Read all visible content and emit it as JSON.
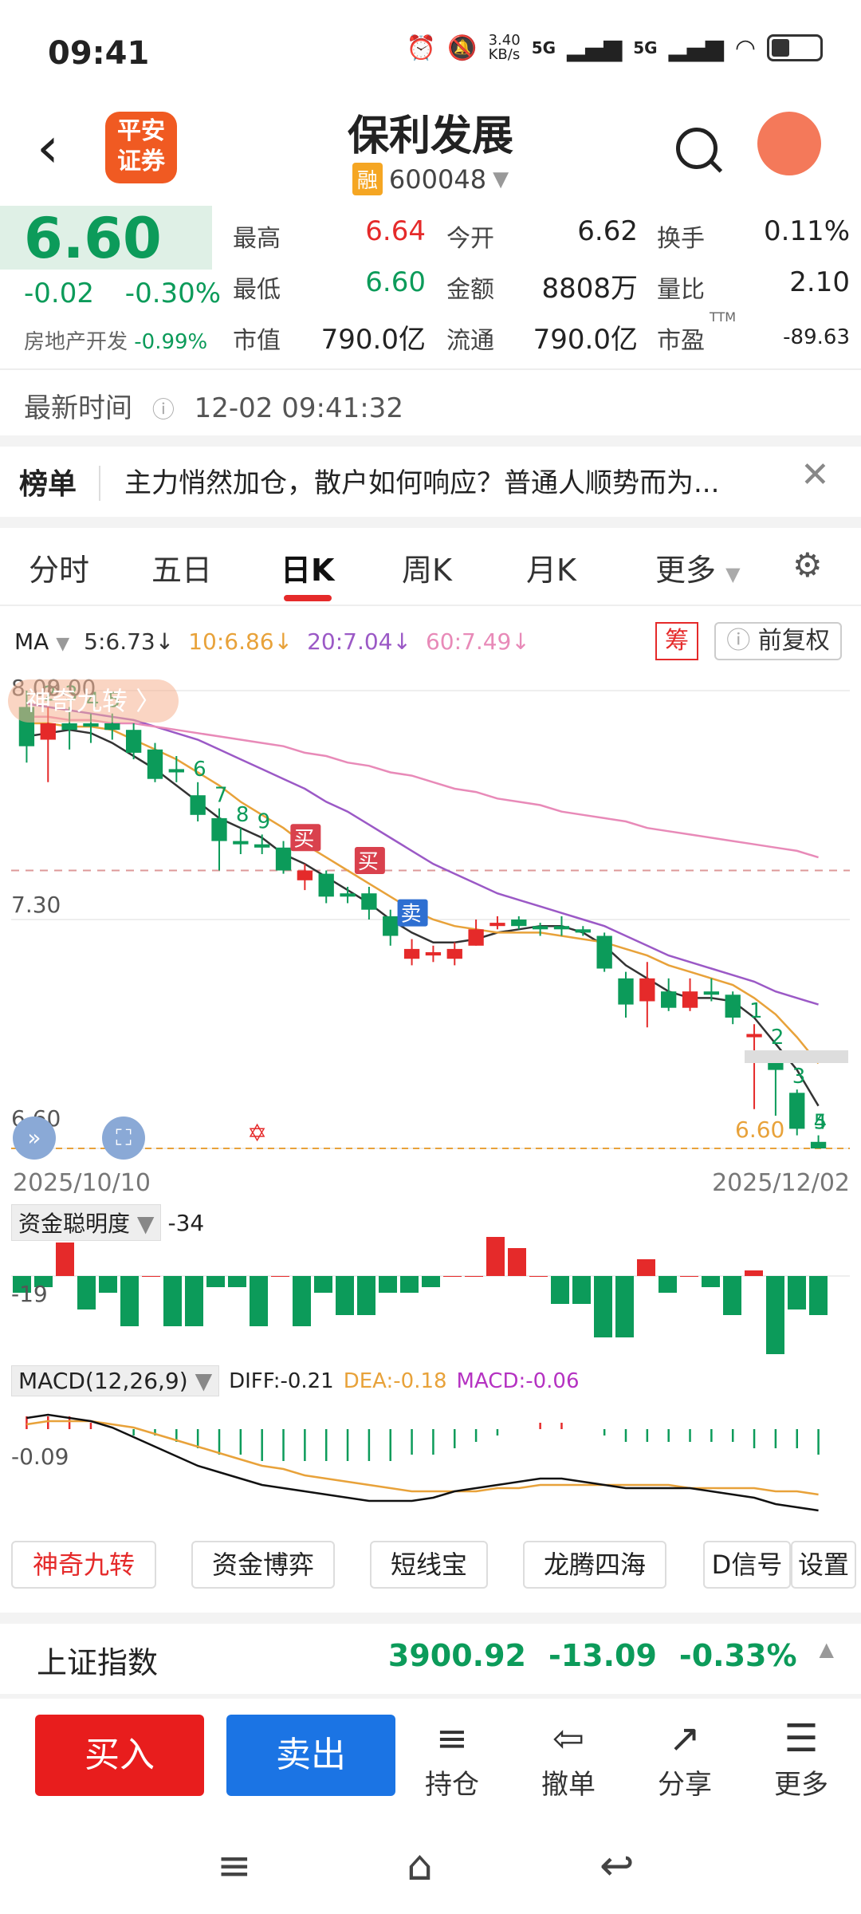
{
  "status": {
    "time": "09:41",
    "net_speed": "3.40\nKB/s",
    "signal1": "5G",
    "signal2": "5G"
  },
  "header": {
    "broker_logo": "平安\n证券",
    "stock_name": "保利发展",
    "rong": "融",
    "stock_code": "600048"
  },
  "quote": {
    "price": "6.60",
    "change": "-0.02",
    "change_pct": "-0.30%",
    "sector": "房地产开发",
    "sector_pct": "-0.99%",
    "items": [
      {
        "label": "最高",
        "value": "6.64",
        "color": "#e52a2a"
      },
      {
        "label": "今开",
        "value": "6.62",
        "color": "#222"
      },
      {
        "label": "换手",
        "value": "0.11%",
        "color": "#222"
      },
      {
        "label": "最低",
        "value": "6.60",
        "color": "#0c9b5a"
      },
      {
        "label": "金额",
        "value": "8808万",
        "color": "#222"
      },
      {
        "label": "量比",
        "value": "2.10",
        "color": "#222"
      },
      {
        "label": "市值",
        "value": "790.0亿",
        "color": "#222"
      },
      {
        "label": "流通",
        "value": "790.0亿",
        "color": "#222"
      },
      {
        "label": "市盈",
        "value": "-89.63",
        "color": "#222"
      }
    ],
    "ttm": "TTM"
  },
  "update": {
    "label": "最新时间",
    "value": "12-02 09:41:32"
  },
  "news": {
    "tag": "榜单",
    "text": "主力悄然加仓，散户如何响应？普通人顺势而为..."
  },
  "tabs": [
    "分时",
    "五日",
    "日K",
    "周K",
    "月K",
    "更多"
  ],
  "ma": {
    "label": "MA",
    "items": [
      {
        "text": "5:6.73↓",
        "color": "#333333"
      },
      {
        "text": "10:6.86↓",
        "color": "#e8a23a"
      },
      {
        "text": "20:7.04↓",
        "color": "#9b59c6"
      },
      {
        "text": "60:7.49↓",
        "color": "#e88ab8"
      }
    ],
    "chou": "筹",
    "fuquan": "前复权"
  },
  "chart": {
    "jiuzhuan": "神奇九转 〉",
    "y_top": "8.00",
    "y_top2": "8.00",
    "y_mid": "7.30",
    "y_bottom": "6.60",
    "last_price_tag": "6.60",
    "date_start": "2025/10/10",
    "date_end": "2025/12/02",
    "buy_tag": "买",
    "sell_tag": "卖"
  },
  "chart_data": {
    "type": "candlestick",
    "ylim": [
      6.6,
      8.0
    ],
    "candles": [
      {
        "o": 7.95,
        "c": 7.83,
        "h": 8.0,
        "l": 7.78
      },
      {
        "o": 7.85,
        "c": 7.9,
        "h": 7.95,
        "l": 7.72
      },
      {
        "o": 7.9,
        "c": 7.88,
        "h": 7.95,
        "l": 7.82
      },
      {
        "o": 7.9,
        "c": 7.89,
        "h": 7.93,
        "l": 7.84
      },
      {
        "o": 7.9,
        "c": 7.88,
        "h": 7.93,
        "l": 7.85
      },
      {
        "o": 7.88,
        "c": 7.81,
        "h": 7.9,
        "l": 7.79
      },
      {
        "o": 7.82,
        "c": 7.73,
        "h": 7.84,
        "l": 7.72
      },
      {
        "o": 7.76,
        "c": 7.75,
        "h": 7.8,
        "l": 7.72
      },
      {
        "o": 7.68,
        "c": 7.62,
        "h": 7.72,
        "l": 7.6
      },
      {
        "o": 7.61,
        "c": 7.54,
        "h": 7.64,
        "l": 7.45
      },
      {
        "o": 7.54,
        "c": 7.53,
        "h": 7.58,
        "l": 7.5
      },
      {
        "o": 7.53,
        "c": 7.52,
        "h": 7.56,
        "l": 7.5
      },
      {
        "o": 7.52,
        "c": 7.45,
        "h": 7.54,
        "l": 7.44
      },
      {
        "o": 7.42,
        "c": 7.45,
        "h": 7.47,
        "l": 7.39
      },
      {
        "o": 7.44,
        "c": 7.37,
        "h": 7.45,
        "l": 7.35
      },
      {
        "o": 7.38,
        "c": 7.37,
        "h": 7.4,
        "l": 7.35
      },
      {
        "o": 7.38,
        "c": 7.33,
        "h": 7.4,
        "l": 7.3
      },
      {
        "o": 7.31,
        "c": 7.25,
        "h": 7.33,
        "l": 7.22
      },
      {
        "o": 7.18,
        "c": 7.21,
        "h": 7.24,
        "l": 7.16
      },
      {
        "o": 7.19,
        "c": 7.2,
        "h": 7.22,
        "l": 7.17
      },
      {
        "o": 7.18,
        "c": 7.21,
        "h": 7.23,
        "l": 7.16
      },
      {
        "o": 7.22,
        "c": 7.27,
        "h": 7.3,
        "l": 7.22
      },
      {
        "o": 7.28,
        "c": 7.29,
        "h": 7.31,
        "l": 7.27
      },
      {
        "o": 7.3,
        "c": 7.28,
        "h": 7.31,
        "l": 7.27
      },
      {
        "o": 7.28,
        "c": 7.27,
        "h": 7.29,
        "l": 7.25
      },
      {
        "o": 7.28,
        "c": 7.27,
        "h": 7.31,
        "l": 7.25
      },
      {
        "o": 7.27,
        "c": 7.26,
        "h": 7.28,
        "l": 7.25
      },
      {
        "o": 7.25,
        "c": 7.15,
        "h": 7.26,
        "l": 7.14
      },
      {
        "o": 7.12,
        "c": 7.04,
        "h": 7.14,
        "l": 7.0
      },
      {
        "o": 7.05,
        "c": 7.12,
        "h": 7.17,
        "l": 6.97
      },
      {
        "o": 7.08,
        "c": 7.03,
        "h": 7.12,
        "l": 7.02
      },
      {
        "o": 7.03,
        "c": 7.08,
        "h": 7.12,
        "l": 7.02
      },
      {
        "o": 7.08,
        "c": 7.07,
        "h": 7.12,
        "l": 7.05
      },
      {
        "o": 7.07,
        "c": 7.0,
        "h": 7.08,
        "l": 6.98
      },
      {
        "o": 6.94,
        "c": 6.95,
        "h": 6.98,
        "l": 6.72
      },
      {
        "o": 6.88,
        "c": 6.84,
        "h": 6.9,
        "l": 6.7
      },
      {
        "o": 6.77,
        "c": 6.66,
        "h": 6.78,
        "l": 6.64
      },
      {
        "o": 6.62,
        "c": 6.6,
        "h": 6.64,
        "l": 6.6
      }
    ],
    "ma_lines": [
      {
        "name": "5",
        "values": [
          7.86,
          7.87,
          7.88,
          7.87,
          7.84,
          7.8,
          7.76,
          7.71,
          7.66,
          7.61,
          7.58,
          7.55,
          7.5,
          7.47,
          7.43,
          7.39,
          7.35,
          7.3,
          7.26,
          7.23,
          7.23,
          7.24,
          7.26,
          7.27,
          7.28,
          7.28,
          7.26,
          7.22,
          7.16,
          7.12,
          7.08,
          7.06,
          7.06,
          7.05,
          7.0,
          6.92,
          6.84,
          6.73
        ]
      },
      {
        "name": "10",
        "values": [
          7.9,
          7.9,
          7.89,
          7.89,
          7.88,
          7.85,
          7.82,
          7.79,
          7.75,
          7.71,
          7.66,
          7.62,
          7.58,
          7.53,
          7.49,
          7.45,
          7.41,
          7.37,
          7.33,
          7.3,
          7.28,
          7.27,
          7.26,
          7.26,
          7.26,
          7.25,
          7.24,
          7.23,
          7.21,
          7.19,
          7.16,
          7.14,
          7.12,
          7.1,
          7.06,
          7.01,
          6.94,
          6.86
        ]
      },
      {
        "name": "20",
        "values": [
          7.96,
          7.95,
          7.94,
          7.93,
          7.92,
          7.91,
          7.89,
          7.87,
          7.85,
          7.82,
          7.79,
          7.76,
          7.73,
          7.7,
          7.66,
          7.63,
          7.59,
          7.55,
          7.51,
          7.47,
          7.44,
          7.41,
          7.38,
          7.36,
          7.34,
          7.32,
          7.3,
          7.28,
          7.25,
          7.22,
          7.19,
          7.17,
          7.15,
          7.13,
          7.11,
          7.08,
          7.06,
          7.04
        ]
      },
      {
        "name": "60",
        "values": [
          7.92,
          7.92,
          7.91,
          7.91,
          7.9,
          7.9,
          7.89,
          7.88,
          7.87,
          7.86,
          7.85,
          7.84,
          7.83,
          7.81,
          7.8,
          7.78,
          7.77,
          7.75,
          7.74,
          7.72,
          7.7,
          7.69,
          7.67,
          7.66,
          7.65,
          7.63,
          7.62,
          7.61,
          7.6,
          7.58,
          7.57,
          7.56,
          7.55,
          7.54,
          7.53,
          7.52,
          7.51,
          7.49
        ]
      }
    ],
    "nine_count_labels": [
      {
        "i": 2,
        "t": "2"
      },
      {
        "i": 3,
        "t": "3"
      },
      {
        "i": 4,
        "t": "4"
      },
      {
        "i": 5,
        "t": "5"
      },
      {
        "i": 9,
        "t": "6"
      },
      {
        "i": 10,
        "t": "7"
      },
      {
        "i": 11,
        "t": "8"
      },
      {
        "i": 12,
        "t": "9"
      },
      {
        "i": 35,
        "t": "1"
      },
      {
        "i": 36,
        "t": "2"
      },
      {
        "i": 37,
        "t": "3"
      },
      {
        "i": 38,
        "t": "4"
      },
      {
        "i": 39,
        "t": "5"
      }
    ]
  },
  "fund_indicator": {
    "label": "资金聪明度",
    "value": "-34",
    "axis": "-19",
    "bars": [
      -3,
      -2,
      6,
      -6,
      -3,
      -9,
      0,
      -9,
      -9,
      -2,
      -2,
      -9,
      0,
      -9,
      -3,
      -7,
      -7,
      -3,
      -3,
      -2,
      0,
      0,
      7,
      5,
      0,
      -5,
      -5,
      -11,
      -11,
      3,
      -3,
      0,
      -2,
      -7,
      1,
      -14,
      -6,
      -7
    ]
  },
  "macd": {
    "label": "MACD(12,26,9)",
    "diff": "DIFF:-0.21",
    "dea": "DEA:-0.18",
    "macd_val": "MACD:-0.06",
    "axis": "-0.09",
    "bars": [
      2,
      2,
      2,
      1,
      0,
      -1,
      -1,
      -2,
      -3,
      -4,
      -4,
      -5,
      -5,
      -5,
      -5,
      -5,
      -5,
      -5,
      -4,
      -4,
      -3,
      -2,
      -1,
      0,
      1,
      1,
      0,
      -1,
      -2,
      -2,
      -2,
      -2,
      -2,
      -2,
      -3,
      -3,
      -3,
      -4
    ],
    "diff_line": [
      0.05,
      0.06,
      0.05,
      0.04,
      0.02,
      -0.01,
      -0.04,
      -0.07,
      -0.1,
      -0.12,
      -0.14,
      -0.16,
      -0.17,
      -0.18,
      -0.19,
      -0.2,
      -0.21,
      -0.21,
      -0.21,
      -0.2,
      -0.18,
      -0.17,
      -0.16,
      -0.15,
      -0.14,
      -0.14,
      -0.15,
      -0.16,
      -0.17,
      -0.17,
      -0.17,
      -0.17,
      -0.18,
      -0.19,
      -0.2,
      -0.22,
      -0.23,
      -0.24
    ],
    "dea_line": [
      0.03,
      0.04,
      0.04,
      0.04,
      0.03,
      0.02,
      0.0,
      -0.02,
      -0.04,
      -0.06,
      -0.08,
      -0.1,
      -0.11,
      -0.13,
      -0.14,
      -0.15,
      -0.16,
      -0.17,
      -0.18,
      -0.18,
      -0.18,
      -0.18,
      -0.17,
      -0.17,
      -0.16,
      -0.16,
      -0.16,
      -0.16,
      -0.16,
      -0.16,
      -0.16,
      -0.17,
      -0.17,
      -0.17,
      -0.17,
      -0.18,
      -0.18,
      -0.19
    ]
  },
  "shortcuts": [
    "神奇九转",
    "资金博弈",
    "短线宝",
    "龙腾四海",
    "D信号",
    "设置"
  ],
  "index": {
    "name": "上证指数",
    "value": "3900.92",
    "change": "-13.09",
    "pct": "-0.33%"
  },
  "actions": {
    "buy": "买入",
    "sell": "卖出",
    "items": [
      {
        "icon": "≡",
        "label": "持仓"
      },
      {
        "icon": "⇦",
        "label": "撤单"
      },
      {
        "icon": "↗",
        "label": "分享"
      },
      {
        "icon": "☰",
        "label": "更多"
      }
    ]
  },
  "colors": {
    "up": "#e52a2a",
    "down": "#0c9b5a",
    "accent": "#e81d1d",
    "sell": "#1b74e4"
  }
}
